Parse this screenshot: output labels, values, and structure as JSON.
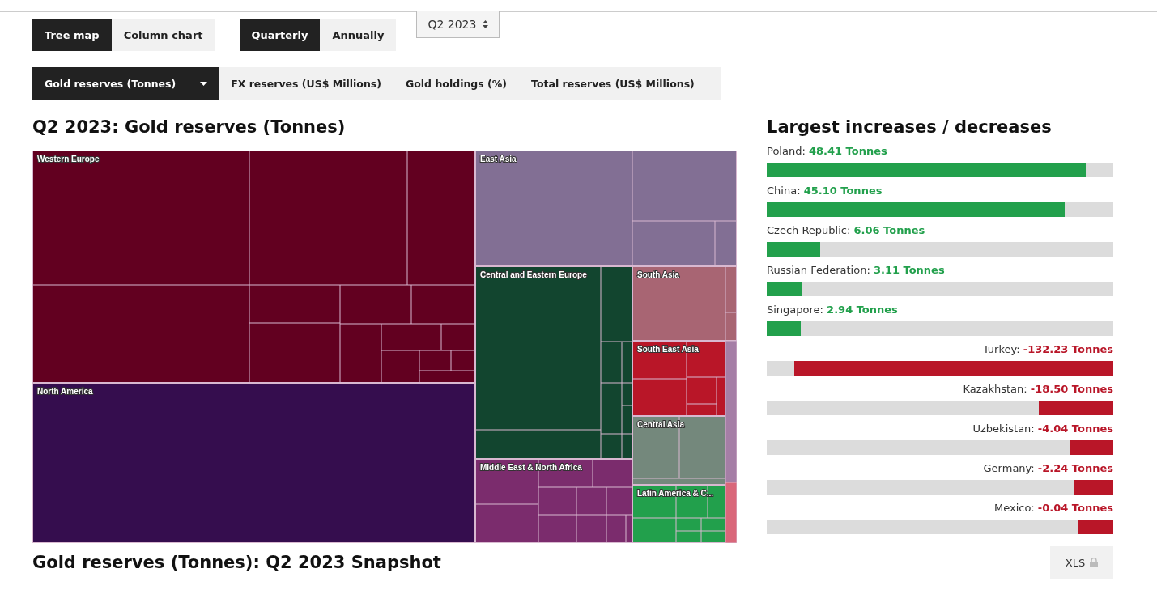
{
  "view_toggle": [
    {
      "label": "Tree map",
      "selected": true
    },
    {
      "label": "Column chart",
      "selected": false
    }
  ],
  "period_toggle": [
    {
      "label": "Quarterly",
      "selected": true
    },
    {
      "label": "Annually",
      "selected": false
    }
  ],
  "period_select": {
    "value": "Q2 2023"
  },
  "metric_tabs": [
    {
      "label": "Gold reserves (Tonnes)",
      "selected": true
    },
    {
      "label": "FX reserves (US$ Millions)",
      "selected": false
    },
    {
      "label": "Gold holdings (%)",
      "selected": false
    },
    {
      "label": "Total reserves (US$ Millions)",
      "selected": false
    }
  ],
  "treemap": {
    "title": "Q2 2023: Gold reserves (Tonnes)",
    "regions": [
      {
        "label": "Western Europe",
        "color": "#620020"
      },
      {
        "label": "North America",
        "color": "#350d4e"
      },
      {
        "label": "East Asia",
        "color": "#826f94"
      },
      {
        "label": "Central and Eastern Europe",
        "color": "#12452f"
      },
      {
        "label": "South Asia",
        "color": "#a86573"
      },
      {
        "label": "South East Asia",
        "color": "#b91628"
      },
      {
        "label": "Central Asia",
        "color": "#74887c"
      },
      {
        "label": "Middle East & North Africa",
        "color": "#7b2c6d"
      },
      {
        "label": "Latin America & C...",
        "color": "#22a04c"
      }
    ]
  },
  "changes": {
    "title": "Largest increases / decreases",
    "items": [
      {
        "kind": "increase",
        "country": "Poland:",
        "amount": "48.41 Tonnes",
        "level": 0.92
      },
      {
        "kind": "increase",
        "country": "China:",
        "amount": "45.10 Tonnes",
        "level": 0.86
      },
      {
        "kind": "increase",
        "country": "Czech Republic:",
        "amount": "6.06 Tonnes",
        "level": 0.155
      },
      {
        "kind": "increase",
        "country": "Russian Federation:",
        "amount": "3.11 Tonnes",
        "level": 0.1
      },
      {
        "kind": "increase",
        "country": "Singapore:",
        "amount": "2.94 Tonnes",
        "level": 0.098
      },
      {
        "kind": "decrease",
        "country": "Turkey:",
        "amount": "-132.23 Tonnes",
        "level": 0.92
      },
      {
        "kind": "decrease",
        "country": "Kazakhstan:",
        "amount": "-18.50 Tonnes",
        "level": 0.215
      },
      {
        "kind": "decrease",
        "country": "Uzbekistan:",
        "amount": "-4.04 Tonnes",
        "level": 0.125
      },
      {
        "kind": "decrease",
        "country": "Germany:",
        "amount": "-2.24 Tonnes",
        "level": 0.114
      },
      {
        "kind": "decrease",
        "country": "Mexico:",
        "amount": "-0.04 Tonnes",
        "level": 0.1
      }
    ]
  },
  "snapshot": {
    "title": "Gold reserves (Tonnes): Q2 2023 Snapshot",
    "export_button": {
      "label": "XLS",
      "locked": true
    }
  }
}
